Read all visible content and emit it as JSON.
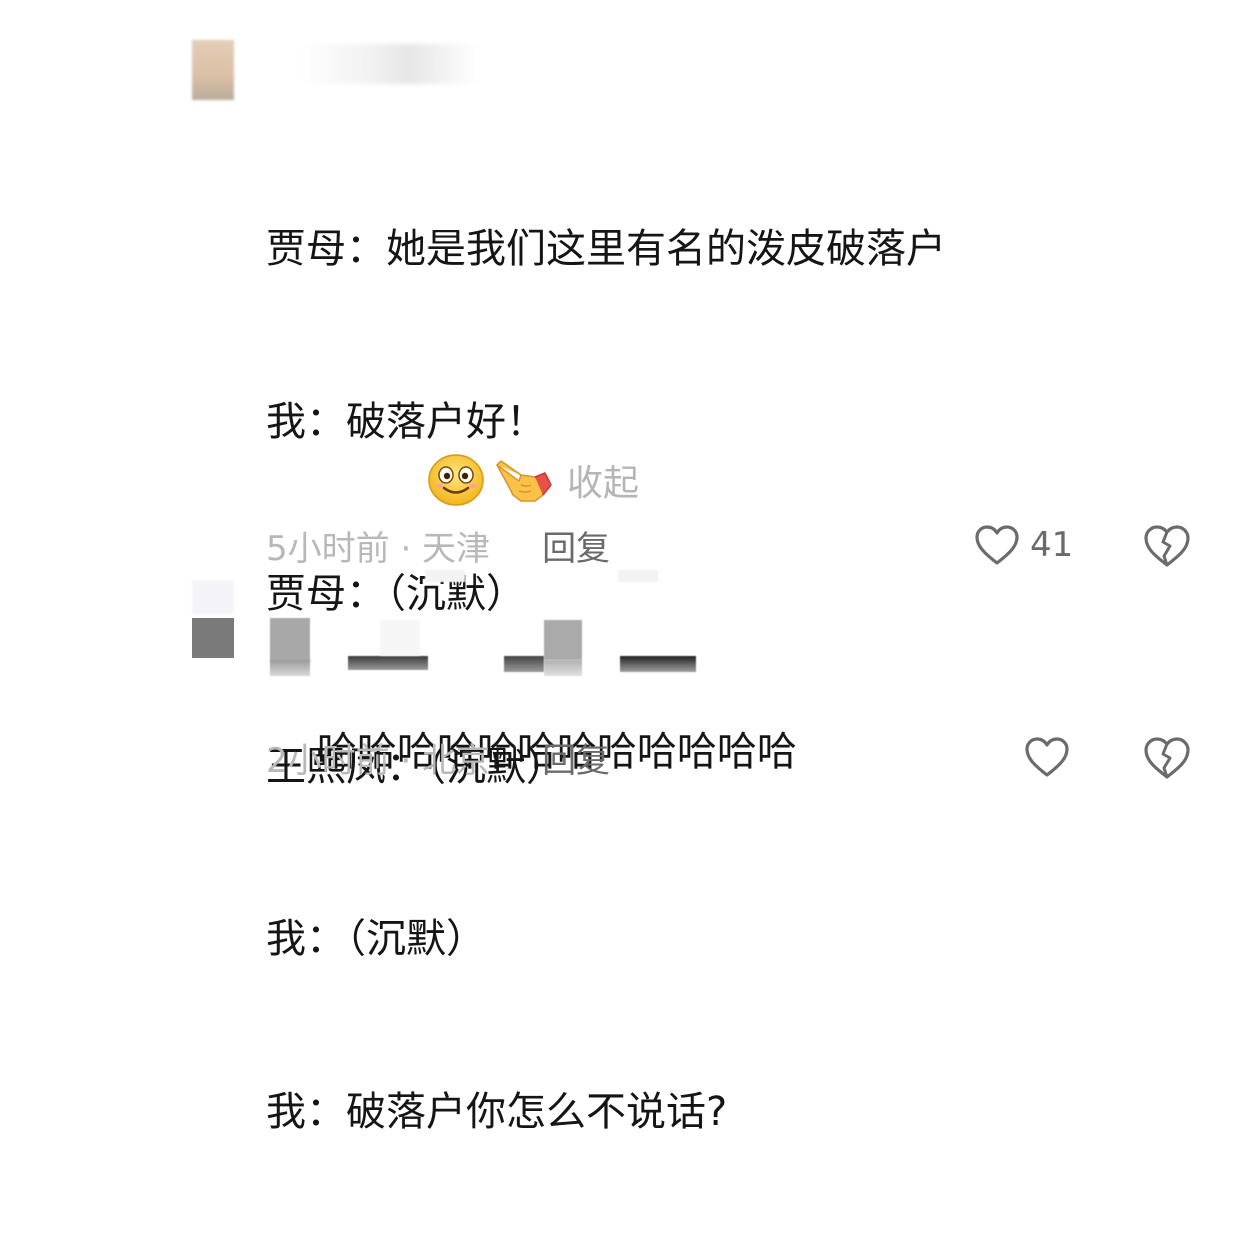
{
  "comments": [
    {
      "lines": [
        "贾母：她是我们这里有名的泼皮破落户",
        "我：破落户好！",
        "贾母：（沉默）",
        "王熙凤：（沉默）",
        "我：（沉默）",
        "我：破落户你怎么不说话?"
      ],
      "emojis": [
        "smiling-face-emoji",
        "pointing-hand-emoji"
      ],
      "collapse_label": "收起",
      "time_location": "5小时前 · 天津",
      "reply_label": "回复",
      "like_count": "41"
    },
    {
      "lines": [
        "哈哈哈哈哈哈哈哈哈哈哈哈"
      ],
      "time_location": "2小时前 · 北京",
      "reply_label": "回复",
      "like_count": ""
    }
  ],
  "colors": {
    "text": "#151515",
    "meta": "#b8b8b8",
    "reply": "#6a6a6a",
    "icon": "#6b6b6b"
  }
}
